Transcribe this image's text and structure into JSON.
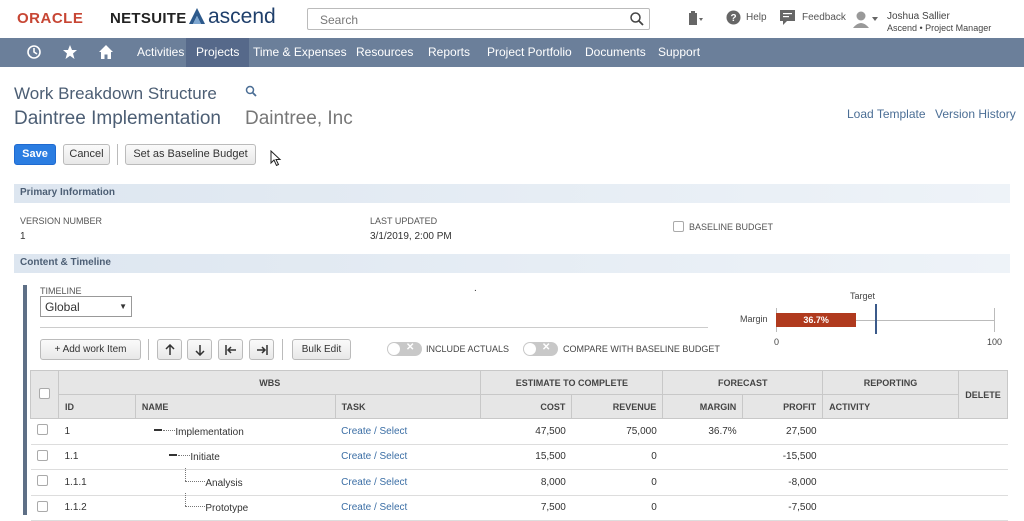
{
  "brand": {
    "oracle": "ORACLE",
    "netsuite": "NETSUITE",
    "ascend": "ascend"
  },
  "search": {
    "placeholder": "Search"
  },
  "topbar": {
    "help": "Help",
    "feedback": "Feedback",
    "user_name": "Joshua Sallier",
    "user_role": "Ascend • Project Manager"
  },
  "nav": {
    "items": [
      "Activities",
      "Projects",
      "Time & Expenses",
      "Resources",
      "Reports",
      "Project Portfolio",
      "Documents",
      "Support"
    ],
    "active": "Projects"
  },
  "page": {
    "title": "Work Breakdown Structure",
    "project": "Daintree Implementation",
    "customer": "Daintree, Inc",
    "load_template": "Load Template",
    "version_history": "Version History"
  },
  "buttons": {
    "save": "Save",
    "cancel": "Cancel",
    "baseline": "Set as Baseline Budget"
  },
  "primary": {
    "header": "Primary Information",
    "version_label": "VERSION NUMBER",
    "version_value": "1",
    "updated_label": "LAST UPDATED",
    "updated_value": "3/1/2019, 2:00 PM",
    "baseline_label": "BASELINE BUDGET"
  },
  "content": {
    "header": "Content & Timeline",
    "timeline_label": "TIMELINE",
    "timeline_value": "Global",
    "dot": "."
  },
  "margin_chart": {
    "label": "Margin",
    "value_label": "36.7%",
    "value": 36.7,
    "target_label": "Target",
    "target": 45,
    "min": "0",
    "max": "100",
    "bar_color": "#b03a1e"
  },
  "toolbar": {
    "add": "+ Add work Item",
    "bulk": "Bulk Edit",
    "include_actuals": "INCLUDE ACTUALS",
    "compare": "COMPARE WITH BASELINE BUDGET"
  },
  "table": {
    "groups": [
      "WBS",
      "ESTIMATE TO COMPLETE",
      "FORECAST",
      "REPORTING",
      "DELETE"
    ],
    "columns": [
      "ID",
      "NAME",
      "TASK",
      "COST",
      "REVENUE",
      "MARGIN",
      "PROFIT",
      "ACTIVITY"
    ],
    "rows": [
      {
        "id": "1",
        "name": "Implementation",
        "task": "Create / Select",
        "cost": "47,500",
        "revenue": "75,000",
        "margin": "36.7%",
        "profit": "27,500"
      },
      {
        "id": "1.1",
        "name": "Initiate",
        "task": "Create / Select",
        "cost": "15,500",
        "revenue": "0",
        "margin": "",
        "profit": "-15,500"
      },
      {
        "id": "1.1.1",
        "name": "Analysis",
        "task": "Create / Select",
        "cost": "8,000",
        "revenue": "0",
        "margin": "",
        "profit": "-8,000"
      },
      {
        "id": "1.1.2",
        "name": "Prototype",
        "task": "Create / Select",
        "cost": "7,500",
        "revenue": "0",
        "margin": "",
        "profit": "-7,500"
      }
    ]
  }
}
